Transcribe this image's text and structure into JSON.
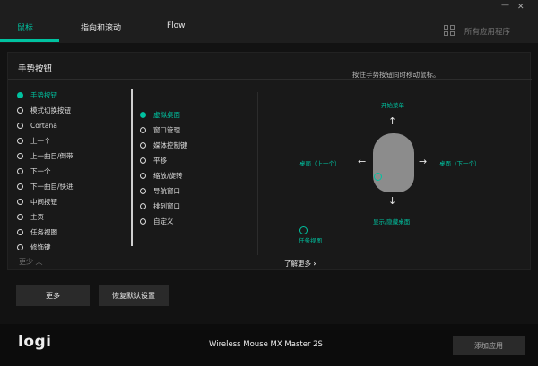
{
  "tabs": [
    {
      "label": "鼠标",
      "active": true
    },
    {
      "label": "指向和滚动",
      "active": false
    },
    {
      "label": "Flow",
      "active": false
    }
  ],
  "app_selector": {
    "icon": "grid-icon",
    "label": "所有应用程序"
  },
  "window_controls": {
    "minimize": "—",
    "close": "✕"
  },
  "panel": {
    "title": "手势按钮",
    "hint": "按住手势按钮同时移动鼠标。"
  },
  "buttons_list": [
    {
      "label": "手势按钮",
      "selected": true
    },
    {
      "label": "模式切换按钮",
      "selected": false
    },
    {
      "label": "Cortana",
      "selected": false
    },
    {
      "label": "上一个",
      "selected": false
    },
    {
      "label": "上一曲目/倒带",
      "selected": false
    },
    {
      "label": "下一个",
      "selected": false
    },
    {
      "label": "下一曲目/快进",
      "selected": false
    },
    {
      "label": "中间按钮",
      "selected": false
    },
    {
      "label": "主页",
      "selected": false
    },
    {
      "label": "任务视图",
      "selected": false
    },
    {
      "label": "修饰键",
      "selected": false
    }
  ],
  "less_label": "更少",
  "actions_list": [
    {
      "label": "虚拟桌面",
      "selected": true
    },
    {
      "label": "窗口管理",
      "selected": false
    },
    {
      "label": "媒体控制键",
      "selected": false
    },
    {
      "label": "平移",
      "selected": false
    },
    {
      "label": "缩放/旋转",
      "selected": false
    },
    {
      "label": "导航窗口",
      "selected": false
    },
    {
      "label": "排列窗口",
      "selected": false
    },
    {
      "label": "自定义",
      "selected": false
    }
  ],
  "gesture": {
    "up": "开始菜单",
    "left": "桌面（上一个）",
    "right": "桌面（下一个）",
    "down": "显示/隐藏桌面",
    "click": "任务视图",
    "arrow_up": "↑",
    "arrow_down": "↓",
    "arrow_left": "←",
    "arrow_right": "→"
  },
  "learn_more": {
    "label": "了解更多",
    "chevron": "›"
  },
  "bottom_buttons": {
    "more": "更多",
    "restore": "恢复默认设置"
  },
  "footer": {
    "logo": "logi",
    "device": "Wireless Mouse MX Master 2S",
    "add_app": "添加应用"
  },
  "colors": {
    "accent": "#00c2a0",
    "background": "#121212",
    "panel": "#191919"
  }
}
